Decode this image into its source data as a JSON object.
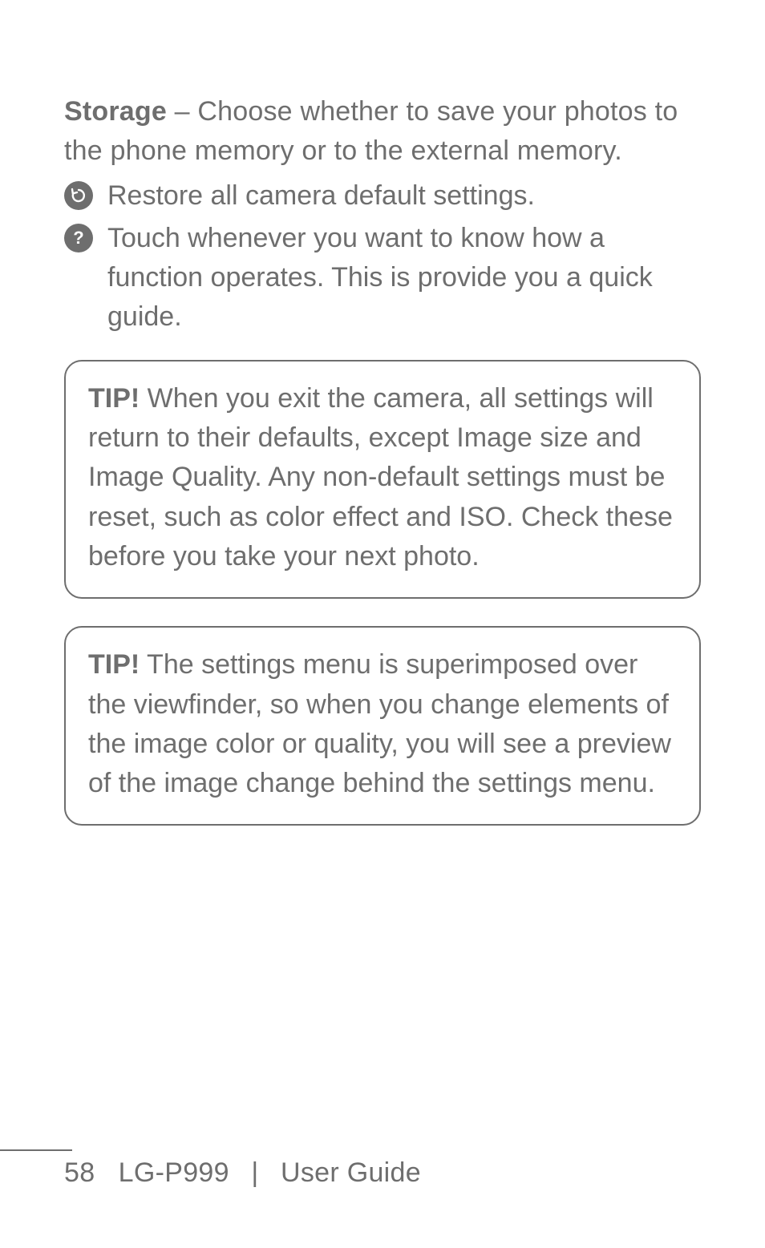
{
  "storage": {
    "label": "Storage",
    "desc": " – Choose whether to save your photos to the phone memory or to the external memory."
  },
  "rows": {
    "restore": {
      "iconName": "reset-icon",
      "text": "Restore all camera default settings."
    },
    "help": {
      "iconName": "help-icon",
      "glyph": "?",
      "text": "Touch whenever you want to know how a function operates. This is provide you a quick guide."
    }
  },
  "tips": {
    "tip1": {
      "label": "TIP!",
      "text": " When you exit the camera, all settings will return to their defaults, except Image size and Image Quality. Any non-default settings must be reset, such as color effect and ISO. Check these before you take your next photo."
    },
    "tip2": {
      "label": "TIP!",
      "text": " The settings menu is superimposed over the viewfinder, so when you change elements of the image color or quality, you will see a preview of the image change behind the settings menu."
    }
  },
  "footer": {
    "pageNumber": "58",
    "model": "LG-P999",
    "separator": "|",
    "docTitle": "User Guide"
  }
}
